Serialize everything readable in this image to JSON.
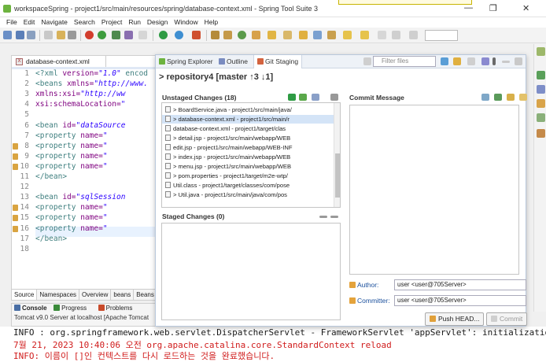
{
  "window": {
    "title": "workspaceSpring - project1/src/main/resources/spring/database-context.xml - Spring Tool Suite 3",
    "controls": [
      "—",
      "❐",
      "✕"
    ]
  },
  "menu": [
    "File",
    "Edit",
    "Navigate",
    "Search",
    "Project",
    "Run",
    "Design",
    "Window",
    "Help"
  ],
  "editor": {
    "tab_label": "database-context.xml",
    "line_numbers": [
      "1",
      "2",
      "3",
      "4",
      "5",
      "6",
      "7",
      "8",
      "9",
      "10",
      "11",
      "12",
      "13",
      "14",
      "15",
      "16",
      "17",
      "18"
    ],
    "lines": [
      {
        "tag": "<?xml ",
        "att": "version=",
        "val": "\"1.0\"",
        "rest": " encod"
      },
      {
        "tag": "<beans ",
        "att": "xmlns=",
        "val": "\"http://www.",
        "rest": ""
      },
      {
        "tag": "    ",
        "att": "xmlns:xsi=",
        "val": "\"http://ww",
        "rest": ""
      },
      {
        "tag": "    ",
        "att": "xsi:schemaLocation=",
        "val": "\"",
        "rest": ""
      },
      {
        "tag": "",
        "att": "",
        "val": "",
        "rest": ""
      },
      {
        "tag": "    <bean ",
        "att": "id=",
        "val": "\"dataSource",
        "rest": ""
      },
      {
        "tag": "        <property ",
        "att": "name=",
        "val": "\"",
        "rest": ""
      },
      {
        "tag": "        <property ",
        "att": "name=",
        "val": "\"",
        "rest": ""
      },
      {
        "tag": "        <property ",
        "att": "name=",
        "val": "\"",
        "rest": ""
      },
      {
        "tag": "        <property ",
        "att": "name=",
        "val": "\"",
        "rest": ""
      },
      {
        "tag": "    </bean>",
        "att": "",
        "val": "",
        "rest": ""
      },
      {
        "tag": "",
        "att": "",
        "val": "",
        "rest": ""
      },
      {
        "tag": "    <bean ",
        "att": "id=",
        "val": "\"sqlSession",
        "rest": ""
      },
      {
        "tag": "        <property ",
        "att": "name=",
        "val": "\"",
        "rest": ""
      },
      {
        "tag": "        <property ",
        "att": "name=",
        "val": "\"",
        "rest": ""
      },
      {
        "tag": "        <property ",
        "att": "name=",
        "val": "\"",
        "rest": ""
      },
      {
        "tag": "    </bean>",
        "att": "",
        "val": "",
        "rest": ""
      },
      {
        "tag": "",
        "att": "",
        "val": "",
        "rest": ""
      }
    ],
    "bottom_tabs": [
      "Source",
      "Namespaces",
      "Overview",
      "beans",
      "Beans G"
    ]
  },
  "console": {
    "tabs": [
      "Console",
      "Progress",
      "Problems"
    ],
    "server": "Tomcat v9.0 Server at localhost [Apache Tomcat"
  },
  "log": [
    {
      "text": "INFO : org.springframework.web.servlet.DispatcherServlet - FrameworkServlet 'appServlet': initialization co",
      "color": "#1a1a1a"
    },
    {
      "text": "7월 21, 2023 10:40:06 오전 org.apache.catalina.core.StandardContext reload",
      "color": "#d01c1c"
    },
    {
      "text": "INFO: 이름이 []인 컨텍스트를 다시 로드하는 것을 완료했습니다.",
      "color": "#d01c1c"
    }
  ],
  "git": {
    "tabs": [
      "Spring Explorer",
      "Outline",
      "Git Staging"
    ],
    "filter_placeholder": "Filter files",
    "repository": "> repository4 [master ↑3 ↓1]",
    "unstaged_header": "Unstaged Changes (18)",
    "unstaged": [
      "> BoardService.java - project1/src/main/java/",
      "> database-context.xml - project1/src/main/r",
      "database-context.xml - project1/target/clas",
      "> detail.jsp - project1/src/main/webapp/WEB",
      "edit.jsp - project1/src/main/webapp/WEB-INF",
      "> index.jsp - project1/src/main/webapp/WEB",
      "> menu.jsp - project1/src/main/webapp/WEB",
      "> pom.properties - project1/target/m2e-wtp/",
      "Util.class - project1/target/classes/com/pose",
      "> Util.java - project1/src/main/java/com/pos"
    ],
    "staged_header": "Staged Changes (0)",
    "commit_header": "Commit Message",
    "author_label": "Author:",
    "author_value": "user <user@705Server>",
    "committer_label": "Committer:",
    "committer_value": "user <user@705Server>",
    "push_label": "Push HEAD...",
    "commit_label": "Commit"
  }
}
